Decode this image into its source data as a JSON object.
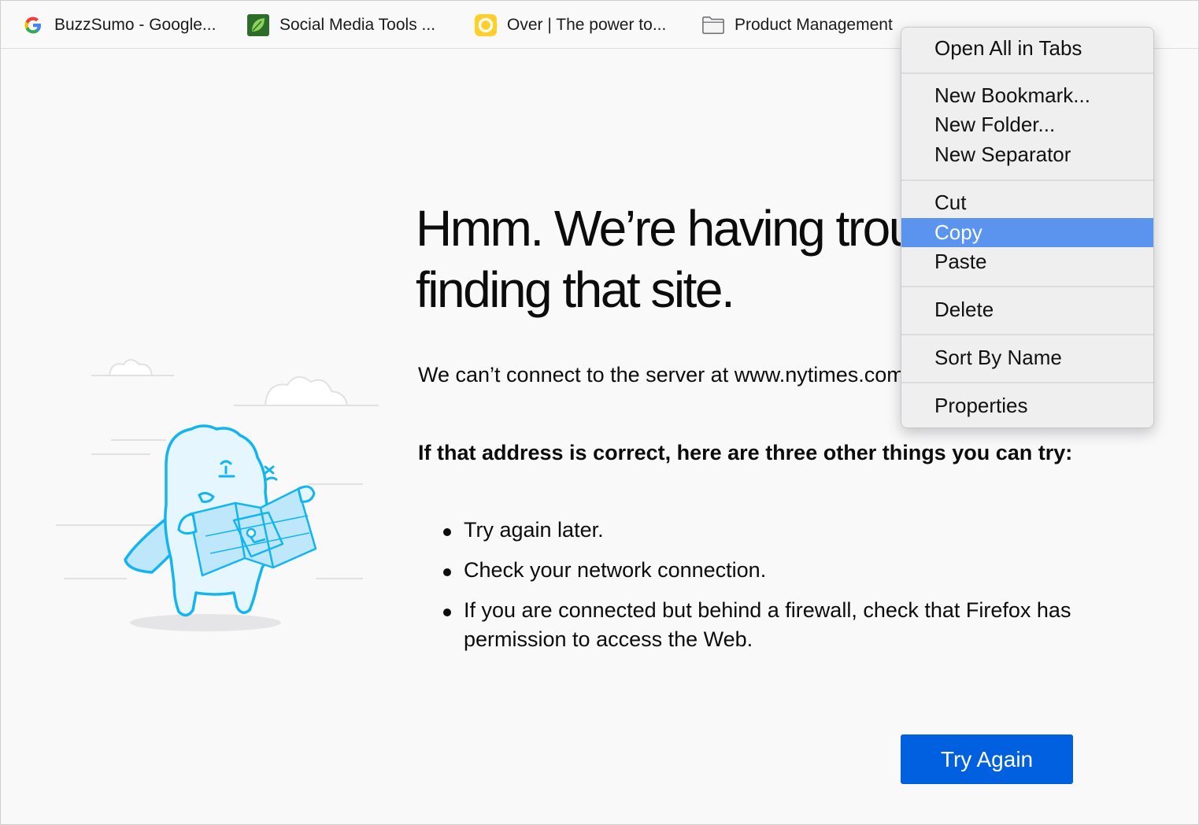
{
  "bookmarks_bar": {
    "items": [
      {
        "label": "BuzzSumo - Google...",
        "icon": "google-g-icon"
      },
      {
        "label": "Social Media Tools ...",
        "icon": "green-leaf-icon"
      },
      {
        "label": "Over | The power to...",
        "icon": "yellow-ring-icon"
      },
      {
        "label": "Product Management",
        "icon": "folder-icon"
      }
    ]
  },
  "error_page": {
    "title_line1": "Hmm. We’re having trouble",
    "title_line2": "finding that site.",
    "description": "We can’t connect to the server at www.nytimes.com.",
    "suggestions_heading": "If that address is correct, here are three other things you can try:",
    "suggestions": [
      "Try again later.",
      "Check your network connection.",
      "If you are connected but behind a firewall, check that Firefox has permission to access the Web."
    ],
    "try_again_label": "Try Again",
    "accent_color": "#0060df"
  },
  "context_menu": {
    "items": [
      {
        "label": "Open All in Tabs"
      },
      {
        "label": "New Bookmark..."
      },
      {
        "label": "New Folder..."
      },
      {
        "label": "New Separator"
      },
      {
        "label": "Cut"
      },
      {
        "label": "Copy",
        "highlighted": true
      },
      {
        "label": "Paste"
      },
      {
        "label": "Delete"
      },
      {
        "label": "Sort By Name"
      },
      {
        "label": "Properties"
      }
    ],
    "highlight_color": "#5b94ee"
  }
}
